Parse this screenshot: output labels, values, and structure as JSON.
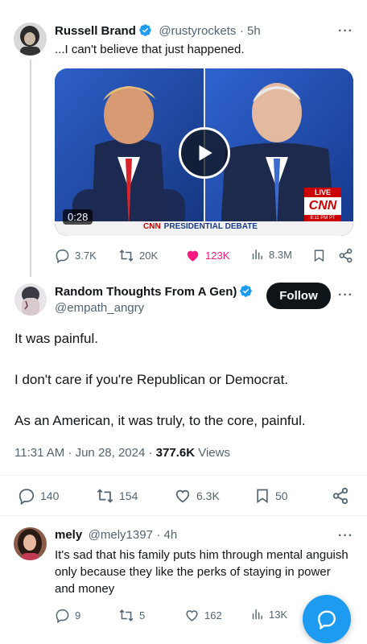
{
  "tweet1": {
    "author_name": "Russell Brand",
    "author_handle": "@rustyrockets",
    "time": "· 5h",
    "text": "...I can't believe that just happened.",
    "video": {
      "duration": "0:28",
      "live_label": "LIVE",
      "network": "CNN",
      "time_label": "8:11 PM PT",
      "lower_third": "PRESIDENTIAL DEBATE"
    },
    "stats": {
      "replies": "3.7K",
      "reposts": "20K",
      "likes": "123K",
      "views": "8.3M"
    }
  },
  "tweet2": {
    "author_name": "Random Thoughts From A Gen)",
    "author_handle": "@empath_angry",
    "follow_label": "Follow",
    "paragraphs": [
      "It was painful.",
      "I don't care if you're Republican or Democrat.",
      "As an American, it was truly, to the core, painful."
    ],
    "timestamp": "11:31 AM · Jun 28, 2024 · ",
    "views_count": "377.6K",
    "views_label": " Views",
    "stats": {
      "replies": "140",
      "reposts": "154",
      "likes": "6.3K",
      "bookmarks": "50"
    }
  },
  "tweet3": {
    "author_name": "mely",
    "author_handle": "@mely1397",
    "time": "· 4h",
    "text": "It's sad that his family puts him through mental anguish only because they like the perks of staying in power and money",
    "stats": {
      "replies": "9",
      "reposts": "5",
      "likes": "162",
      "views": "13K"
    }
  },
  "colors": {
    "verified": "#1d9bf0",
    "like": "#f91880",
    "fab": "#1d9bf0",
    "muted": "#536471"
  }
}
